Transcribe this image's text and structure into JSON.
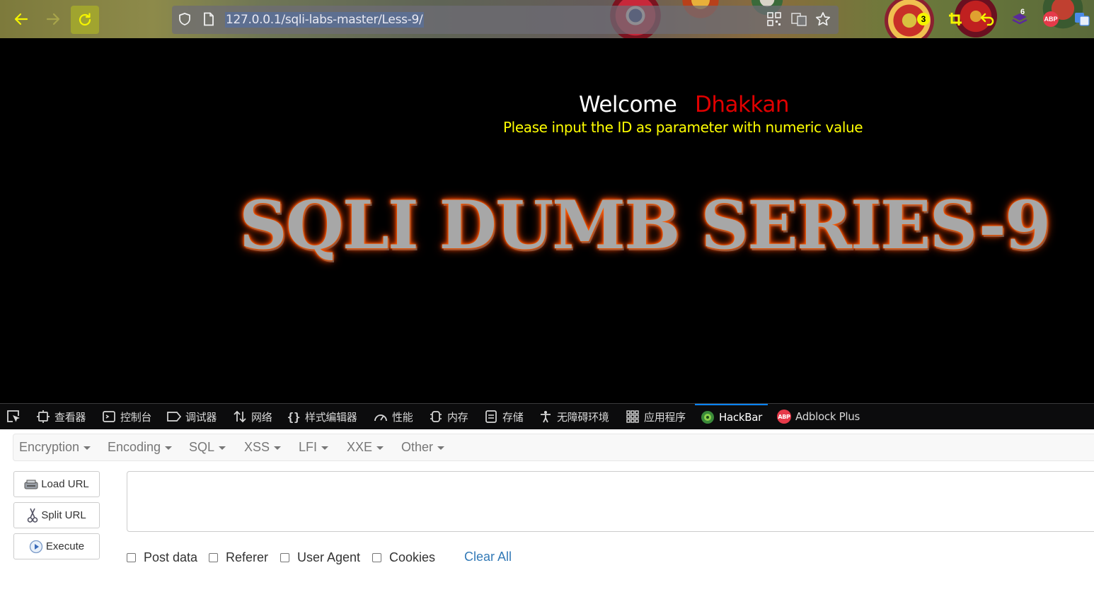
{
  "browser": {
    "url": "127.0.0.1/sqli-labs-master/Less-9/",
    "extension_badges": {
      "notifications": "3",
      "extension_count": "6",
      "adblock": "ABP"
    }
  },
  "page": {
    "welcome": "Welcome",
    "welcome_name": "Dhakkan",
    "instruction": "Please input the ID as parameter with numeric value",
    "banner": "SQLI DUMB SERIES-9"
  },
  "devtools": {
    "tabs": [
      {
        "label": "查看器",
        "icon": "inspector-icon"
      },
      {
        "label": "控制台",
        "icon": "console-icon"
      },
      {
        "label": "调试器",
        "icon": "debugger-icon"
      },
      {
        "label": "网络",
        "icon": "network-icon"
      },
      {
        "label": "样式编辑器",
        "icon": "style-editor-icon"
      },
      {
        "label": "性能",
        "icon": "performance-icon"
      },
      {
        "label": "内存",
        "icon": "memory-icon"
      },
      {
        "label": "存储",
        "icon": "storage-icon"
      },
      {
        "label": "无障碍环境",
        "icon": "accessibility-icon"
      },
      {
        "label": "应用程序",
        "icon": "application-icon"
      },
      {
        "label": "HackBar",
        "icon": "hackbar-icon",
        "active": true
      },
      {
        "label": "Adblock Plus",
        "icon": "adblock-plus-icon"
      }
    ]
  },
  "hackbar": {
    "menu": [
      "Encryption",
      "Encoding",
      "SQL",
      "XSS",
      "LFI",
      "XXE",
      "Other"
    ],
    "buttons": {
      "load_url": "Load URL",
      "split_url": "Split URL",
      "execute": "Execute"
    },
    "textarea_value": "",
    "checkboxes": [
      {
        "label": "Post data",
        "checked": false
      },
      {
        "label": "Referer",
        "checked": false
      },
      {
        "label": "User Agent",
        "checked": false
      },
      {
        "label": "Cookies",
        "checked": false
      }
    ],
    "clear_all": "Clear All"
  },
  "colors": {
    "page_background": "#000000",
    "welcome_name": "#e00000",
    "instruction": "#ffff00",
    "banner_glow": "#ff5400",
    "active_tab_accent": "#0a84ff",
    "link": "#337ab7"
  }
}
